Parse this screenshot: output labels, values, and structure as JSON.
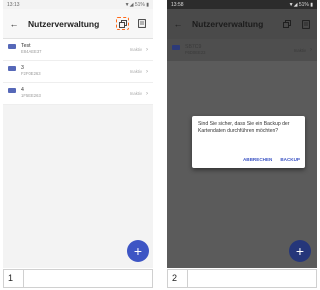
{
  "screen1": {
    "status": {
      "time": "13:13",
      "right": "▼◢ 51% ▮"
    },
    "title": "Nutzerverwaltung",
    "icons": {
      "back": "arrow-left-icon",
      "copy": "copy-icon",
      "menu": "document-icon"
    },
    "rows": [
      {
        "name": "Test",
        "id": "E84AEE37",
        "status": "Inaktiv"
      },
      {
        "name": "3",
        "id": "F2F0E263",
        "status": "Inaktiv"
      },
      {
        "name": "4",
        "id": "1F5EE263",
        "status": "Inaktiv"
      }
    ],
    "fab": "+",
    "caption": "1"
  },
  "screen2": {
    "status": {
      "time": "13:58",
      "right": "▼◢ 51% ▮"
    },
    "title": "Nutzerverwaltung",
    "rows": [
      {
        "name": "SB7C9",
        "id": "F6D0EE23",
        "status": "Inaktiv"
      }
    ],
    "dialog": {
      "message": "Sind Sie sicher, dass Sie ein Backup der Kartendaten durchführen möchten?",
      "cancel": "ABBRECHEN",
      "confirm": "BACKUP"
    },
    "fab": "+",
    "caption": "2"
  },
  "colors": {
    "accent": "#3d55c4",
    "highlight": "#ff6a1a"
  }
}
